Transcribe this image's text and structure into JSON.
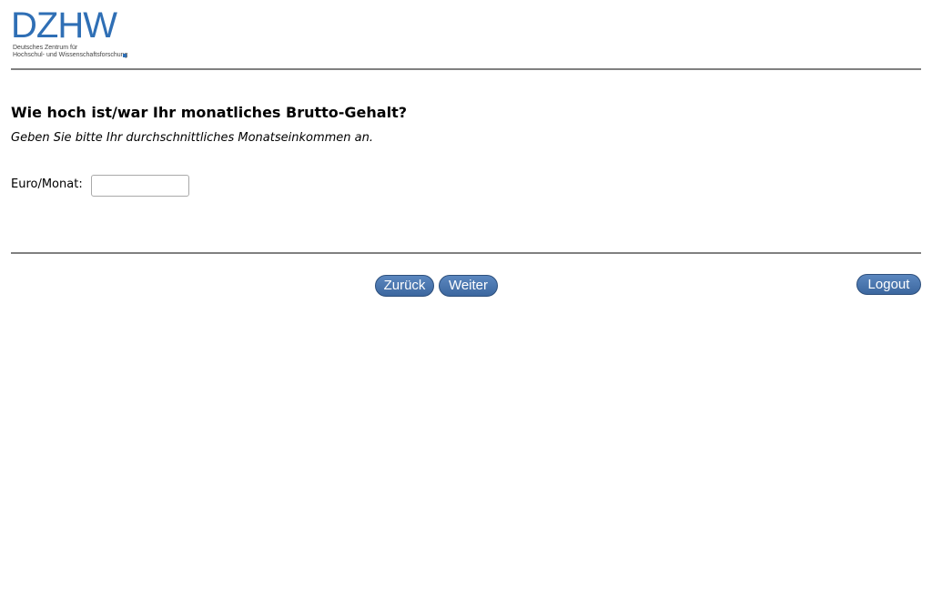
{
  "header": {
    "logo_text": "DZHW",
    "logo_line1": "Deutsches Zentrum für",
    "logo_line2": "Hochschul- und Wissenschaftsforschung"
  },
  "question": {
    "title": "Wie hoch ist/war Ihr monatliches Brutto-Gehalt?",
    "hint": "Geben Sie bitte Ihr durchschnittliches Monatseinkommen an."
  },
  "form": {
    "label": "Euro/Monat:",
    "value": "",
    "placeholder": ""
  },
  "nav": {
    "back_label": "Zurück",
    "next_label": "Weiter",
    "logout_label": "Logout"
  },
  "colors": {
    "brand": "#2f6fb5",
    "button": "#4a77b1",
    "rule": "#808080"
  }
}
